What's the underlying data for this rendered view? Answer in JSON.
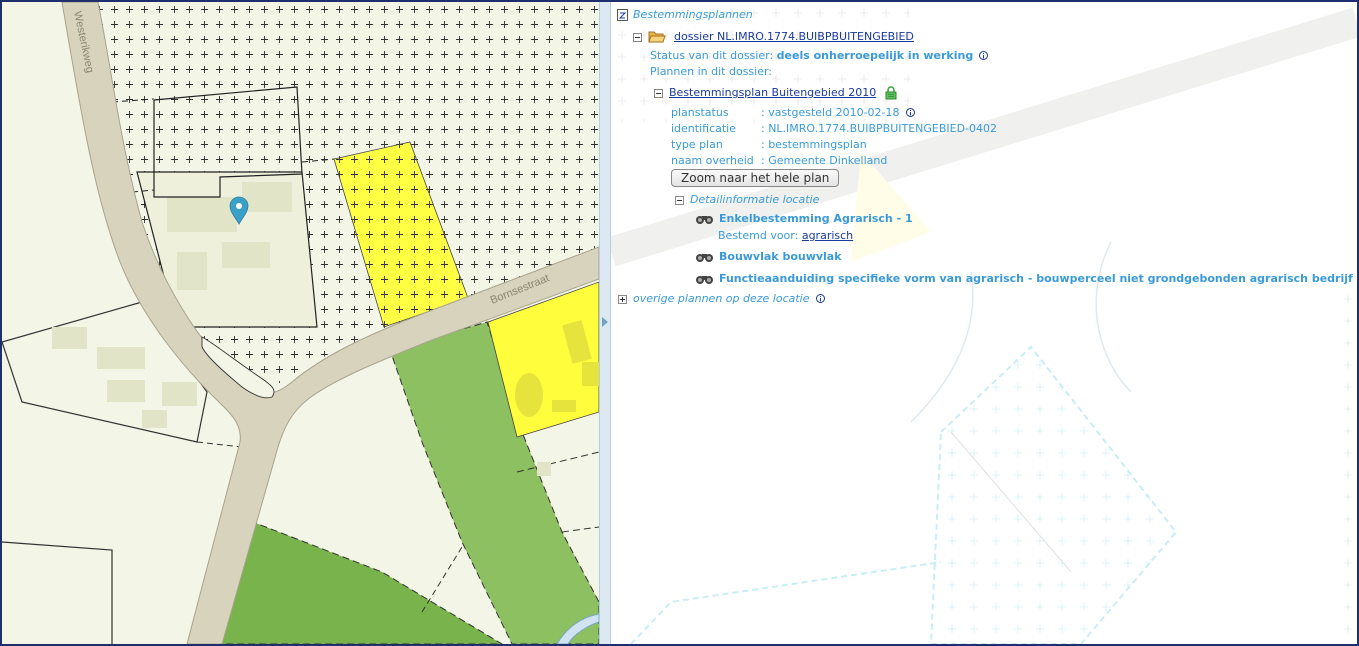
{
  "map": {
    "street_labels": [
      "Westerikweg",
      "Bornsestraat"
    ],
    "marker_icon": "map-pin-icon",
    "colors": {
      "background": "#f3f5e6",
      "road": "#d8d3bc",
      "agrarian_yellow": "#ffff44",
      "farm_yellow": "#fffd3c",
      "green_light": "#8cc060",
      "green_dark": "#78b34b",
      "marker": "#3aa0c8"
    }
  },
  "panel": {
    "root_label": "Bestemmingsplannen",
    "dossier": {
      "label": "dossier NL.IMRO.1774.BUIBPBUITENGEBIED",
      "status_label": "Status van dit dossier:",
      "status_value": "deels onherroepelijk in werking",
      "plans_label": "Plannen in dit dossier:"
    },
    "plan": {
      "name": "Bestemmingsplan Buitengebied 2010",
      "fields": [
        {
          "label": "planstatus",
          "value": ": vastgesteld 2010-02-18"
        },
        {
          "label": "identificatie",
          "value": ": NL.IMRO.1774.BUIBPBUITENGEBIED-0402"
        },
        {
          "label": "type plan",
          "value": ": bestemmingsplan"
        },
        {
          "label": "naam overheid",
          "value": ": Gemeente Dinkelland"
        }
      ],
      "zoom_button": "Zoom naar het hele plan"
    },
    "detail": {
      "label": "Detailinformatie locatie",
      "items": [
        {
          "title": "Enkelbestemming Agrarisch - 1",
          "sub_label": "Bestemd voor:",
          "sub_link": "agrarisch"
        },
        {
          "title": "Bouwvlak bouwvlak"
        },
        {
          "title": "Functieaanduiding specifieke vorm van agrarisch - bouwperceel niet grondgebonden agrarisch bedrijf"
        }
      ]
    },
    "other_plans": "overige plannen op deze locatie"
  }
}
